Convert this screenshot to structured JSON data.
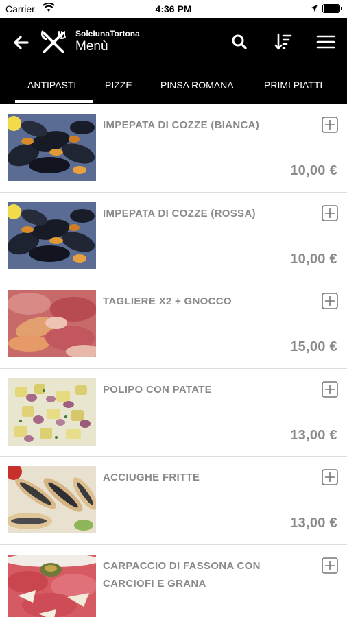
{
  "status_bar": {
    "carrier": "Carrier",
    "time": "4:36 PM"
  },
  "header": {
    "restaurant_name": "SoleIunaTortona",
    "title": "Menù",
    "background": "#000000",
    "icons": [
      "back-arrow-icon",
      "fork-knife-icon",
      "search-icon",
      "sort-icon",
      "hamburger-menu-icon"
    ]
  },
  "tabs": [
    {
      "label": "ANTIPASTI",
      "active": true
    },
    {
      "label": "PIZZE",
      "active": false
    },
    {
      "label": "PINSA ROMANA",
      "active": false
    },
    {
      "label": "PRIMI PIATTI",
      "active": false
    }
  ],
  "items": [
    {
      "name": "IMPEPATA DI COZZE (BIANCA)",
      "price": "10,00 €",
      "image": "mussels-photo"
    },
    {
      "name": "IMPEPATA DI COZZE (ROSSA)",
      "price": "10,00 €",
      "image": "mussels-photo"
    },
    {
      "name": "TAGLIERE X2 + GNOCCO",
      "price": "15,00 €",
      "image": "cured-meats-photo"
    },
    {
      "name": "POLIPO CON PATATE",
      "price": "13,00 €",
      "image": "octopus-potatoes-photo"
    },
    {
      "name": "ACCIUGHE FRITTE",
      "price": "13,00 €",
      "image": "fried-anchovies-photo"
    },
    {
      "name": "CARPACCIO DI FASSONA CON CARCIOFI E GRANA",
      "price": "",
      "image": "carpaccio-photo"
    }
  ],
  "colors": {
    "text_muted": "#8a8a8a",
    "divider": "#dddddd"
  }
}
